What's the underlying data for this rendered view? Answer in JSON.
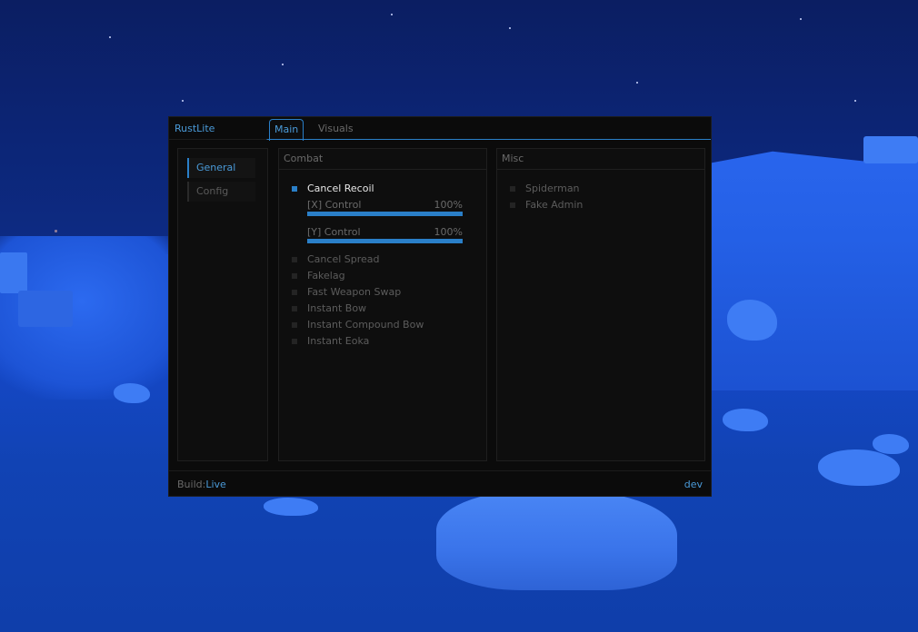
{
  "menu": {
    "brand": "RustLite",
    "tabs": {
      "main": "Main",
      "visuals": "Visuals"
    },
    "nav": {
      "general": "General",
      "config": "Config"
    },
    "combat": {
      "title": "Combat",
      "cancel_recoil": {
        "label": "Cancel Recoil",
        "enabled": true
      },
      "x_control": {
        "label": "[X] Control",
        "value_text": "100%",
        "fill_fraction": 1.0
      },
      "y_control": {
        "label": "[Y] Control",
        "value_text": "100%",
        "fill_fraction": 1.0
      },
      "options": [
        {
          "label": "Cancel Spread",
          "enabled": false
        },
        {
          "label": "Fakelag",
          "enabled": false
        },
        {
          "label": "Fast Weapon Swap",
          "enabled": false
        },
        {
          "label": "Instant Bow",
          "enabled": false
        },
        {
          "label": "Instant Compound Bow",
          "enabled": false
        },
        {
          "label": "Instant Eoka",
          "enabled": false
        }
      ]
    },
    "misc": {
      "title": "Misc",
      "options": [
        {
          "label": "Spiderman",
          "enabled": false
        },
        {
          "label": "Fake Admin",
          "enabled": false
        }
      ]
    },
    "footer": {
      "build_label": "Build:",
      "build_value": "Live",
      "right_text": "dev"
    },
    "colors": {
      "accent": "#2a7fc8",
      "accent_text": "#4a9ad8",
      "background": "#0b0b0b"
    }
  }
}
